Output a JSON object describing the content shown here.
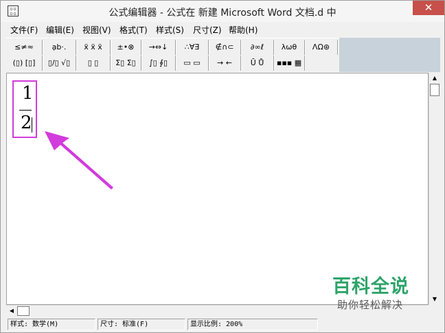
{
  "window": {
    "title": "公式编辑器 - 公式在 新建 Microsoft Word 文档.d 中",
    "app_icon": "formula-editor-icon",
    "close_glyph": "✕"
  },
  "menu": [
    "文件(F)",
    "编辑(E)",
    "视图(V)",
    "格式(T)",
    "样式(S)",
    "尺寸(Z)",
    "帮助(H)"
  ],
  "toolbar": {
    "row1": [
      "≤≠≈",
      "ạb·.",
      "ẍ ẍ ẍ",
      "±•⊗",
      "→⇔↓",
      "∴∀∃",
      "∉∩⊂",
      "∂∞ℓ",
      "λωθ",
      "ΛΩ⊛"
    ],
    "row2": [
      "(▯) [▯]",
      "▯/▯ √▯",
      "▯ ▯",
      "Σ▯ Σ▯",
      "∫▯ ∮▯",
      "▭ ▭",
      "→ ←",
      "Ū Ů",
      "▪▪▪ ▦"
    ]
  },
  "equation": {
    "numerator": "1",
    "denominator": "2"
  },
  "scrollbar": {
    "up_glyph": "▲",
    "down_glyph": "▼",
    "left_glyph": "◀"
  },
  "status": {
    "style": "样式: 数学(M)",
    "size": "尺寸: 标准(F)",
    "zoom": "显示比例: 200%"
  },
  "watermark": {
    "title": "百科全说",
    "subtitle": "助你轻松解决"
  },
  "colors": {
    "highlight": "#d23bdc",
    "watermark": "#2ea46a",
    "close": "#c7504a"
  }
}
